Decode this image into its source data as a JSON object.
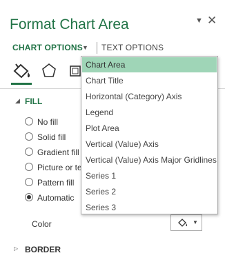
{
  "pane": {
    "title": "Format Chart Area"
  },
  "tabs": {
    "chart_options": "CHART OPTIONS",
    "text_options": "TEXT OPTIONS"
  },
  "fill": {
    "header": "FILL",
    "options": [
      {
        "label": "No fill",
        "checked": false
      },
      {
        "label": "Solid fill",
        "checked": false
      },
      {
        "label": "Gradient fill",
        "checked": false
      },
      {
        "label": "Picture or te",
        "checked": false
      },
      {
        "label": "Pattern fill",
        "checked": false
      },
      {
        "label": "Automatic",
        "checked": true
      }
    ],
    "color_label": "Color"
  },
  "border": {
    "header": "BORDER"
  },
  "dropdown": {
    "selected": "Chart Area",
    "items": [
      "Chart Area",
      "Chart Title",
      "Horizontal (Category) Axis",
      "Legend",
      "Plot Area",
      "Vertical (Value) Axis",
      "Vertical (Value) Axis Major Gridlines",
      "Series 1",
      "Series 2",
      "Series 3"
    ]
  },
  "colors": {
    "accent": "#217346",
    "highlight": "#9fd5b7"
  }
}
